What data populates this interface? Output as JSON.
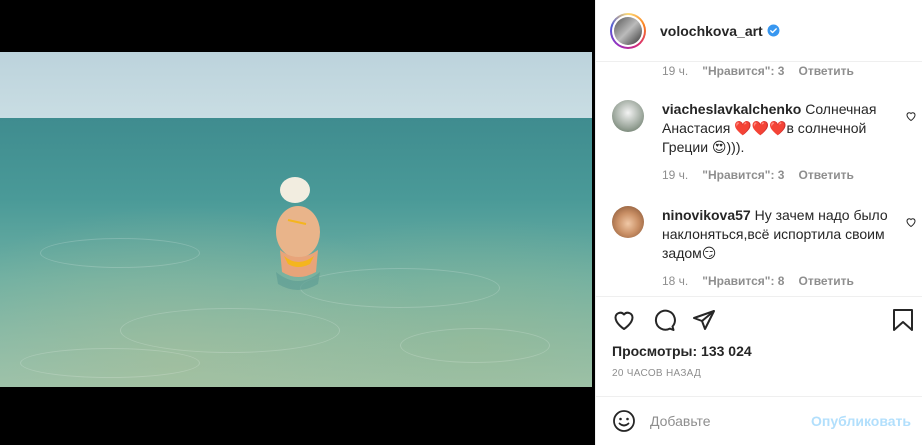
{
  "post": {
    "username": "volochkova_art",
    "verified_icon": "verified-badge-icon",
    "brand_color": "#3897f0"
  },
  "media": {
    "mute_icon": "speaker-icon"
  },
  "comments": {
    "top_meta": {
      "time": "19 ч.",
      "likes": "\"Нравится\": 3",
      "reply": "Ответить"
    },
    "items": [
      {
        "username": "viacheslavkalchenko",
        "text": " Солнечная Анастасия ❤️❤️❤️в солнечной Греции 😍))).",
        "time": "19 ч.",
        "likes": "\"Нравится\": 3",
        "reply": "Ответить"
      },
      {
        "username": "ninovikova57",
        "text": " Ну зачем надо было наклоняться,всё испортила своим задом😏",
        "time": "18 ч.",
        "likes": "\"Нравится\": 8",
        "reply": "Ответить"
      }
    ]
  },
  "actions": {
    "like_icon": "heart-icon",
    "comment_icon": "comment-icon",
    "share_icon": "send-icon",
    "save_icon": "bookmark-icon",
    "views": "Просмотры: 133 024",
    "posted_ago": "20 ЧАСОВ НАЗАД"
  },
  "add_comment": {
    "placeholder": "Добавьте",
    "publish_label": "Опубликовать",
    "publish_color": "#b2dffc"
  }
}
